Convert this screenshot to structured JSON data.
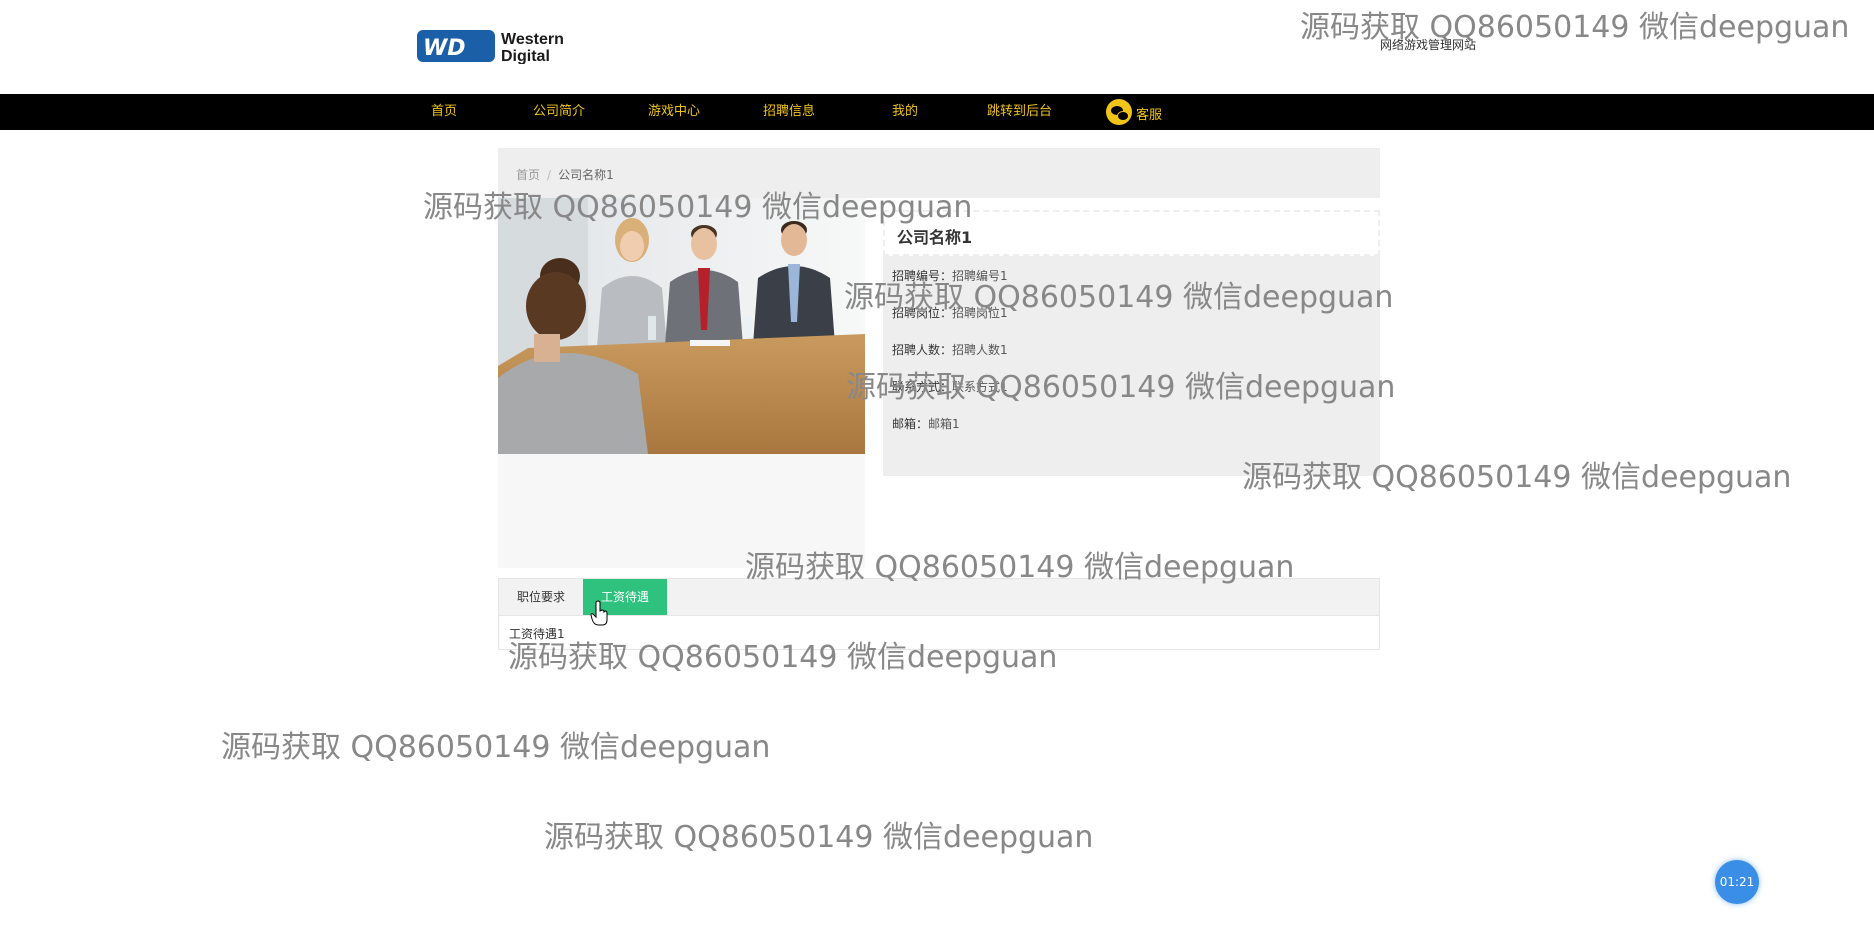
{
  "header": {
    "logo_text_line1": "Western",
    "logo_text_line2": "Digital",
    "site_subtitle": "网络游戏管理网站"
  },
  "nav": {
    "items": [
      {
        "label": "首页"
      },
      {
        "label": "公司简介"
      },
      {
        "label": "游戏中心"
      },
      {
        "label": "招聘信息"
      },
      {
        "label": "我的"
      },
      {
        "label": "跳转到后台"
      },
      {
        "label": "客服"
      }
    ]
  },
  "breadcrumb": {
    "home": "首页",
    "separator": "/",
    "current": "公司名称1"
  },
  "company": {
    "name": "公司名称1",
    "fields": [
      {
        "label": "招聘编号：",
        "value": "招聘编号1"
      },
      {
        "label": "招聘岗位：",
        "value": "招聘岗位1"
      },
      {
        "label": "招聘人数：",
        "value": "招聘人数1"
      },
      {
        "label": "联系方式：",
        "value": "联系方式1"
      },
      {
        "label": "邮箱：",
        "value": "邮箱1"
      }
    ]
  },
  "tabs": {
    "items": [
      {
        "label": "职位要求",
        "active": false
      },
      {
        "label": "工资待遇",
        "active": true
      }
    ],
    "content": "工资待遇1"
  },
  "watermark": "源码获取 QQ86050149 微信deepguan",
  "timer": "01:21",
  "colors": {
    "nav_bg": "#000000",
    "nav_text": "#f0c419",
    "tab_active": "#2ec27e",
    "panel_bg": "#eeeeee",
    "timer": "#3a8ee6"
  }
}
